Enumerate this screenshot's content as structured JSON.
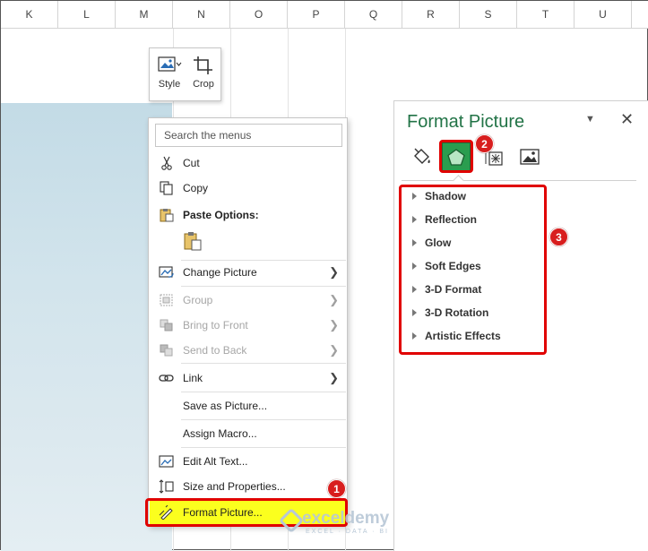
{
  "columns": [
    "K",
    "L",
    "M",
    "N",
    "O",
    "P",
    "Q",
    "R",
    "S",
    "T",
    "U"
  ],
  "mini_toolbar": {
    "style_label": "Style",
    "crop_label": "Crop"
  },
  "context_menu": {
    "search_placeholder": "Search the menus",
    "items": {
      "cut": "Cut",
      "copy": "Copy",
      "paste_options": "Paste Options:",
      "change_picture": "Change Picture",
      "group": "Group",
      "bring_to_front": "Bring to Front",
      "send_to_back": "Send to Back",
      "link": "Link",
      "save_as_picture": "Save as Picture...",
      "assign_macro": "Assign Macro...",
      "edit_alt_text": "Edit Alt Text...",
      "size_and_properties": "Size and Properties...",
      "format_picture": "Format Picture..."
    }
  },
  "format_pane": {
    "title": "Format Picture",
    "sections": [
      "Shadow",
      "Reflection",
      "Glow",
      "Soft Edges",
      "3-D Format",
      "3-D Rotation",
      "Artistic Effects"
    ],
    "active_tab": "effects",
    "tabs": [
      "fill-line",
      "effects",
      "size-properties",
      "picture"
    ]
  },
  "badges": [
    "1",
    "2",
    "3"
  ],
  "watermark": {
    "brand": "exceldemy",
    "tagline": "EXCEL · DATA · BI"
  },
  "colors": {
    "accent_green": "#217346",
    "highlight_yellow": "#fbff1e",
    "annotation_red": "#e00000"
  }
}
